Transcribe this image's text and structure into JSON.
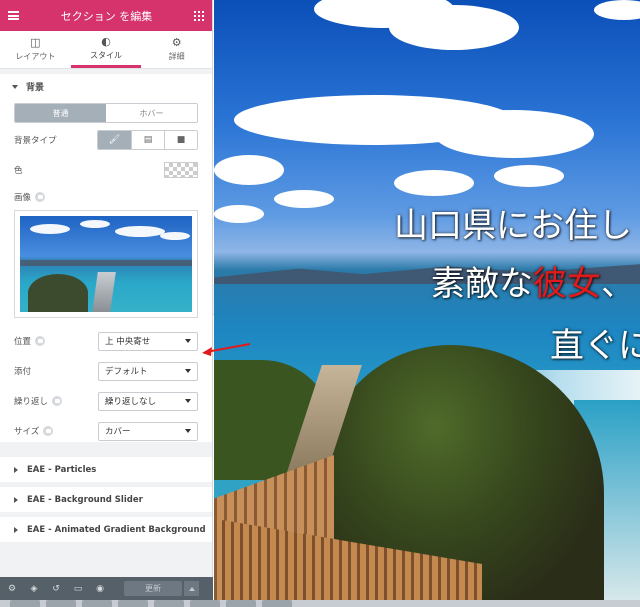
{
  "topbar": {
    "title": "セクション を編集"
  },
  "tabs": [
    {
      "label": "レイアウト",
      "icon": "layout-icon"
    },
    {
      "label": "スタイル",
      "icon": "contrast-icon",
      "active": true
    },
    {
      "label": "詳細",
      "icon": "gear-icon"
    }
  ],
  "background": {
    "heading": "背景",
    "normal_label": "普通",
    "hover_label": "ホバー",
    "bgtype_label": "背景タイプ",
    "color_label": "色",
    "image_label": "画像",
    "position_label": "位置",
    "position_value": "上 中央寄せ",
    "attachment_label": "添付",
    "attachment_value": "デフォルト",
    "repeat_label": "繰り返し",
    "repeat_value": "繰り返しなし",
    "size_label": "サイズ",
    "size_value": "カバー"
  },
  "collapsed_sections": [
    "EAE - Particles",
    "EAE - Background Slider",
    "EAE - Animated Gradient Background"
  ],
  "footer": {
    "update_label": "更新"
  },
  "preview": {
    "line1": "山口県にお住し",
    "line2_pre": "素敵な",
    "line2_red": "彼女",
    "line2_post": "、",
    "line3": "直ぐに"
  },
  "colors": {
    "accent": "#d6336c",
    "highlight_red": "#e11b1b"
  }
}
